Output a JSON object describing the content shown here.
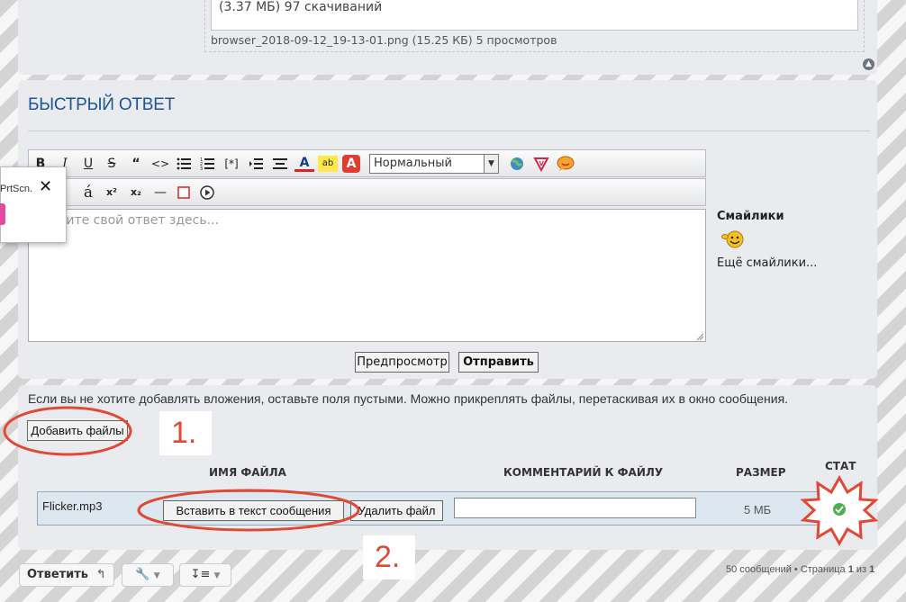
{
  "attachments_top": {
    "info_text": "(3.37 МБ) 97 скачиваний",
    "file_line": "browser_2018-09-12_19-13-01.png (15.25 КБ) 5 просмотров"
  },
  "quick_reply": {
    "title": "БЫСТРЫЙ ОТВЕТ",
    "font_select": "Нормальный",
    "editor_placeholder": "...ите свой ответ здесь...",
    "smilies_title": "Смайлики",
    "more_smilies": "Ещё смайлики...",
    "preview_label": "Предпросмотр",
    "submit_label": "Отправить",
    "toolbar_row1": [
      "B",
      "I",
      "U",
      "S",
      "“",
      "<>",
      "list-icon",
      "ordered-list-icon",
      "[*]",
      "indent-icon",
      "align-icon",
      "A",
      "ab",
      "A"
    ],
    "toolbar_row2": [
      "á",
      "x²",
      "x₂",
      "—",
      "□",
      "▶"
    ]
  },
  "attachments": {
    "hint": "Если вы не хотите добавлять вложения, оставьте поля пустыми. Можно прикреплять файлы, перетаскивая их в окно сообщения.",
    "add_files_label": "Добавить файлы",
    "col_name": "ИМЯ ФАЙЛА",
    "col_comment": "КОММЕНТАРИЙ К ФАЙЛУ",
    "col_size": "РАЗМЕР",
    "col_status": "СТАТ",
    "row": {
      "file_name": "Flicker.mp3",
      "insert_label": "Вставить в текст сообщения",
      "delete_label": "Удалить файл",
      "comment_value": "",
      "size": "5 МБ"
    }
  },
  "annotations": {
    "step1": "1.",
    "step2": "2."
  },
  "footer": {
    "reply_label": "Ответить",
    "pagination_prefix": "50 сообщений • Страница ",
    "page_current": "1",
    "pagination_mid": " из ",
    "page_total": "1"
  },
  "popup": {
    "text": "PrtScn.",
    "close": "✕"
  },
  "colors": {
    "accent_title": "#1b5596",
    "annotation_red": "#e04a35",
    "panel_bg": "#e9ebee",
    "status_ok": "#4caf50"
  }
}
